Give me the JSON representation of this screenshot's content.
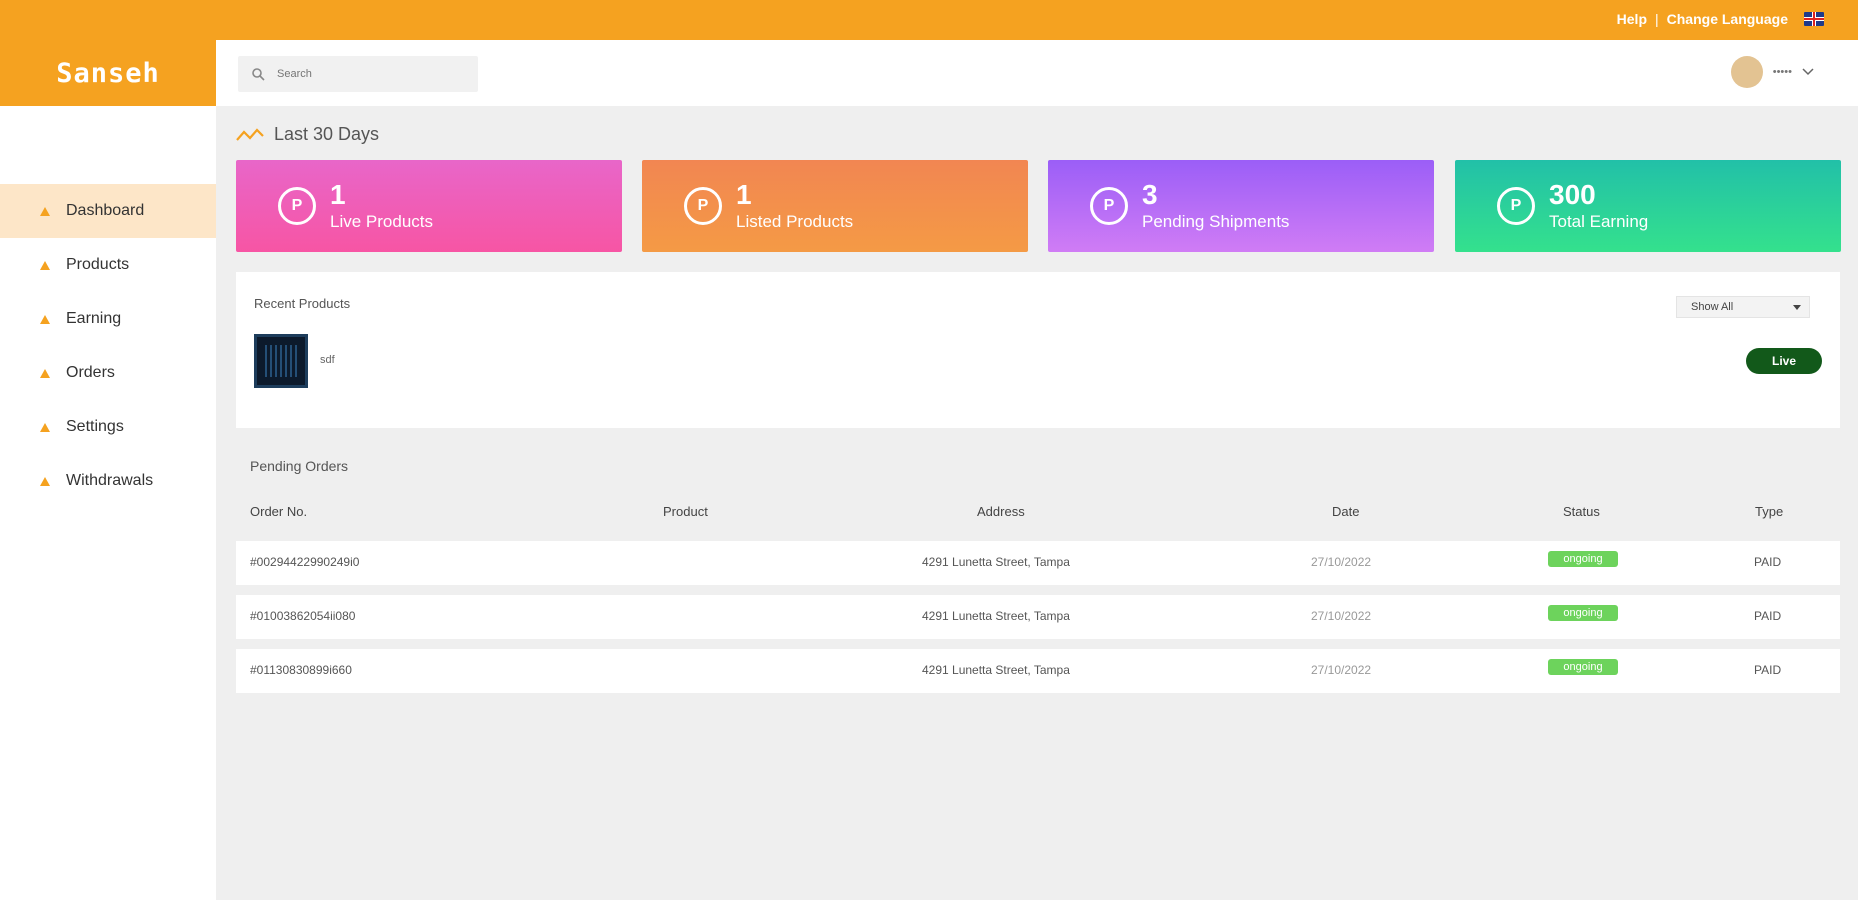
{
  "topbar": {
    "help": "Help",
    "separator": "|",
    "language": "Change Language"
  },
  "brand": {
    "logo": "Sanseh"
  },
  "search": {
    "placeholder": "Search"
  },
  "user": {
    "name": "•••••"
  },
  "sidebar": {
    "items": [
      {
        "label": "Dashboard",
        "active": true
      },
      {
        "label": "Products"
      },
      {
        "label": "Earning"
      },
      {
        "label": "Orders"
      },
      {
        "label": "Settings"
      },
      {
        "label": "Withdrawals"
      }
    ]
  },
  "summary": {
    "title": "Last 30 Days",
    "cards": [
      {
        "value": "1",
        "label": "Live Products",
        "icon": "P"
      },
      {
        "value": "1",
        "label": "Listed Products",
        "icon": "P"
      },
      {
        "value": "3",
        "label": "Pending Shipments",
        "icon": "P"
      },
      {
        "value": "300",
        "label": "Total Earning",
        "icon": "P"
      }
    ]
  },
  "recent_products": {
    "title": "Recent Products",
    "filter": "Show All",
    "items": [
      {
        "name": "sdf",
        "status": "Live"
      }
    ]
  },
  "pending_orders": {
    "title": "Pending Orders",
    "columns": [
      "Order No.",
      "Product",
      "Address",
      "Date",
      "Status",
      "Type"
    ],
    "rows": [
      {
        "order_no": "#00294422990249i0",
        "product": "",
        "address": "4291 Lunetta Street, Tampa",
        "date": "27/10/2022",
        "status": "ongoing",
        "type": "PAID"
      },
      {
        "order_no": "#01003862054ii080",
        "product": "",
        "address": "4291 Lunetta Street, Tampa",
        "date": "27/10/2022",
        "status": "ongoing",
        "type": "PAID"
      },
      {
        "order_no": "#01130830899i660",
        "product": "",
        "address": "4291 Lunetta Street, Tampa",
        "date": "27/10/2022",
        "status": "ongoing",
        "type": "PAID"
      }
    ]
  }
}
